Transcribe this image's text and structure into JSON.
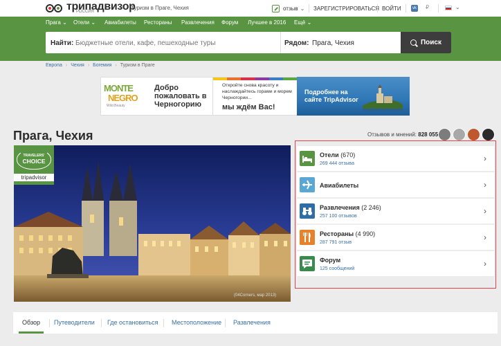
{
  "header": {
    "logo_text": "трипадвизор",
    "logo_sub": "РОССИЯ",
    "crumb": "Туризм в Праге, Чехия",
    "review_label": "отзыв",
    "register_label": "ЗАРЕГИСТРИРОВАТЬСЯ",
    "login_label": "ВОЙТИ",
    "vk_label": "vk",
    "currency_label": "₽",
    "flag_colors": [
      "#ffffff",
      "#1c4fb8",
      "#d52b1e"
    ]
  },
  "nav": [
    {
      "label": "Прага ⌄"
    },
    {
      "label": "Отели ⌄"
    },
    {
      "label": "Авиабилеты"
    },
    {
      "label": "Рестораны"
    },
    {
      "label": "Развлечения"
    },
    {
      "label": "Форум"
    },
    {
      "label": "Лучшее в 2016"
    },
    {
      "label": "Ещё ⌄"
    }
  ],
  "search": {
    "find_label": "Найти:",
    "find_placeholder": "Бюджетные отели, кафе, пешеходные туры",
    "near_label": "Рядом:",
    "near_value": "Прага, Чехия",
    "button_label": "Поиск"
  },
  "breadcrumb": [
    "Европа",
    "Чехия",
    "Богемия",
    "Туризм в Праге"
  ],
  "ad": {
    "logo_line1": "MONTE",
    "logo_line2": "NEGRO",
    "logo_line3": "Wild Beauty",
    "panel_a": "Добро пожаловать в Черногорию",
    "panel_b_text": "Откройте снова красоту и наслаждайтесь горами и морем Черногории...",
    "panel_b_strong": "мы ждём Вас!",
    "panel_c": "Подробнее на сайте TripAdvisor",
    "stripe_colors": [
      "#f5c518",
      "#e8712b",
      "#d8324b",
      "#8a3c9e",
      "#3b7dc4",
      "#5aa640"
    ]
  },
  "page": {
    "title": "Прага, Чехия",
    "reviews_label": "Отзывов и мнений:",
    "reviews_count": "828 055",
    "avatar_colors": [
      "#7c7c7c",
      "#a8a8a8",
      "#c0582f",
      "#2b2b2b"
    ]
  },
  "hero": {
    "badge_line1": "TRAVELERS'",
    "badge_line2": "CHOICE",
    "badge_line3": "tripadvisor",
    "credit": "(04Corners, мар 2013)"
  },
  "categories": [
    {
      "title": "Отели",
      "count": "(670)",
      "sub": "269 444 отзыва",
      "color": "#589442",
      "icon": "bed-icon"
    },
    {
      "title": "Авиабилеты",
      "count": "",
      "sub": "",
      "color": "#5ba7d4",
      "icon": "plane-icon"
    },
    {
      "title": "Развлечения",
      "count": "(2 246)",
      "sub": "257 100 отзывов",
      "color": "#2f6da6",
      "icon": "binoculars-icon"
    },
    {
      "title": "Рестораны",
      "count": "(4 990)",
      "sub": "287 791 отзыв",
      "color": "#e8822a",
      "icon": "fork-knife-icon"
    },
    {
      "title": "Форум",
      "count": "",
      "sub": "125 сообщений",
      "color": "#3a8a4e",
      "icon": "chat-icon"
    }
  ],
  "tabs": [
    {
      "label": "Обзор"
    },
    {
      "label": "Путеводители"
    },
    {
      "label": "Где остановиться"
    },
    {
      "label": "Местоположение"
    },
    {
      "label": "Развлечения"
    }
  ],
  "accent": "#589442",
  "link_color": "#3a6fa3",
  "highlight_border": "#e2434b"
}
